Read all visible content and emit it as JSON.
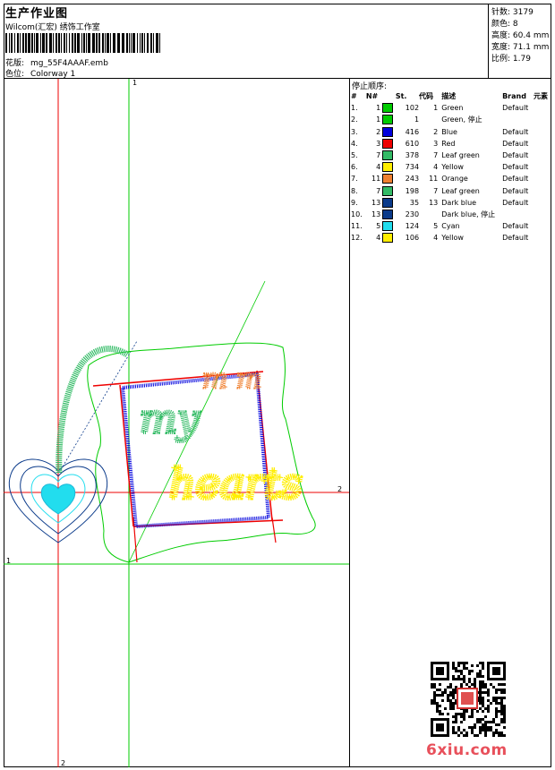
{
  "header": {
    "title": "生产作业图",
    "company": "Wilcom(汇宏) 绣饰工作室",
    "design_label": "花版:",
    "design_file": "mg_55F4AAAF.emb",
    "colorway_label": "色位:",
    "colorway": "Colorway 1"
  },
  "stats": [
    {
      "label": "针数:",
      "value": "3179"
    },
    {
      "label": "颜色:",
      "value": "8"
    },
    {
      "label": "高度:",
      "value": "60.4 mm"
    },
    {
      "label": "宽度:",
      "value": "71.1 mm"
    },
    {
      "label": "比例:",
      "value": "1.79"
    }
  ],
  "stop_sequence": {
    "title": "停止顺序:",
    "headers": [
      "#",
      "N#",
      "St.",
      "代码",
      "描述",
      "Brand",
      "元素"
    ],
    "rows": [
      {
        "no": "1.",
        "n": "1",
        "color": "#00cc00",
        "st": "102",
        "code": "1",
        "desc": "Green",
        "brand": "Default"
      },
      {
        "no": "2.",
        "n": "1",
        "color": "#00cc00",
        "st": "1",
        "code": "",
        "desc": "Green, 停止",
        "brand": ""
      },
      {
        "no": "3.",
        "n": "2",
        "color": "#0000dd",
        "st": "416",
        "code": "2",
        "desc": "Blue",
        "brand": "Default"
      },
      {
        "no": "4.",
        "n": "3",
        "color": "#ee0000",
        "st": "610",
        "code": "3",
        "desc": "Red",
        "brand": "Default"
      },
      {
        "no": "5.",
        "n": "7",
        "color": "#33bb66",
        "st": "378",
        "code": "7",
        "desc": "Leaf green",
        "brand": "Default"
      },
      {
        "no": "6.",
        "n": "4",
        "color": "#ffee00",
        "st": "734",
        "code": "4",
        "desc": "Yellow",
        "brand": "Default"
      },
      {
        "no": "7.",
        "n": "11",
        "color": "#f08030",
        "st": "243",
        "code": "11",
        "desc": "Orange",
        "brand": "Default"
      },
      {
        "no": "8.",
        "n": "7",
        "color": "#33bb66",
        "st": "198",
        "code": "7",
        "desc": "Leaf green",
        "brand": "Default"
      },
      {
        "no": "9.",
        "n": "13",
        "color": "#0a3a8a",
        "st": "35",
        "code": "13",
        "desc": "Dark blue",
        "brand": "Default"
      },
      {
        "no": "10.",
        "n": "13",
        "color": "#0a3a8a",
        "st": "230",
        "code": "",
        "desc": "Dark blue, 停止",
        "brand": ""
      },
      {
        "no": "11.",
        "n": "5",
        "color": "#22ddee",
        "st": "124",
        "code": "5",
        "desc": "Cyan",
        "brand": "Default"
      },
      {
        "no": "12.",
        "n": "4",
        "color": "#ffee00",
        "st": "106",
        "code": "4",
        "desc": "Yellow",
        "brand": "Default"
      }
    ]
  },
  "design": {
    "guide_labels": {
      "top": "1",
      "left": "1",
      "right": "2",
      "bottom": "2"
    },
    "text_my": "my",
    "text_hearts": "hearts",
    "text_top": "m m"
  },
  "watermark": "6xiu.com"
}
